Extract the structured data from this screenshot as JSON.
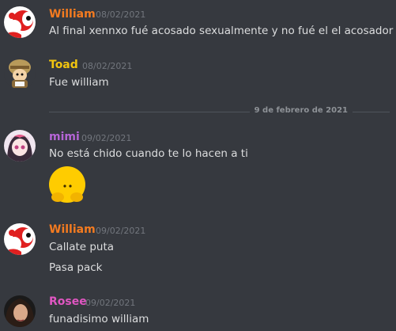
{
  "messages": [
    {
      "username": "William",
      "username_color": "#f47b20",
      "timestamp": "08/02/2021",
      "lines": [
        "Al final xennxo fué acosado sexualmente y no fué el el acosador"
      ]
    },
    {
      "username": "Toad",
      "username_color": "#f1c40f",
      "timestamp": "08/02/2021",
      "lines": [
        "Fue william"
      ]
    },
    {
      "username": "mimi",
      "username_color": "#b565d6",
      "timestamp": "09/02/2021",
      "lines": [
        "No está chido cuando te lo hacen a ti"
      ],
      "emoji": "flushed-pleading-emoji"
    },
    {
      "username": "William",
      "username_color": "#f47b20",
      "timestamp": "09/02/2021",
      "lines": [
        "Callate puta",
        "Pasa pack"
      ]
    },
    {
      "username": "Rosee",
      "username_color": "#e056c2",
      "timestamp": "09/02/2021",
      "lines": [
        "funadisimo william"
      ]
    }
  ],
  "date_divider": "9 de febrero de 2021",
  "colors": {
    "background": "#36393f",
    "text": "#dcddde",
    "timestamp": "#72767d"
  }
}
